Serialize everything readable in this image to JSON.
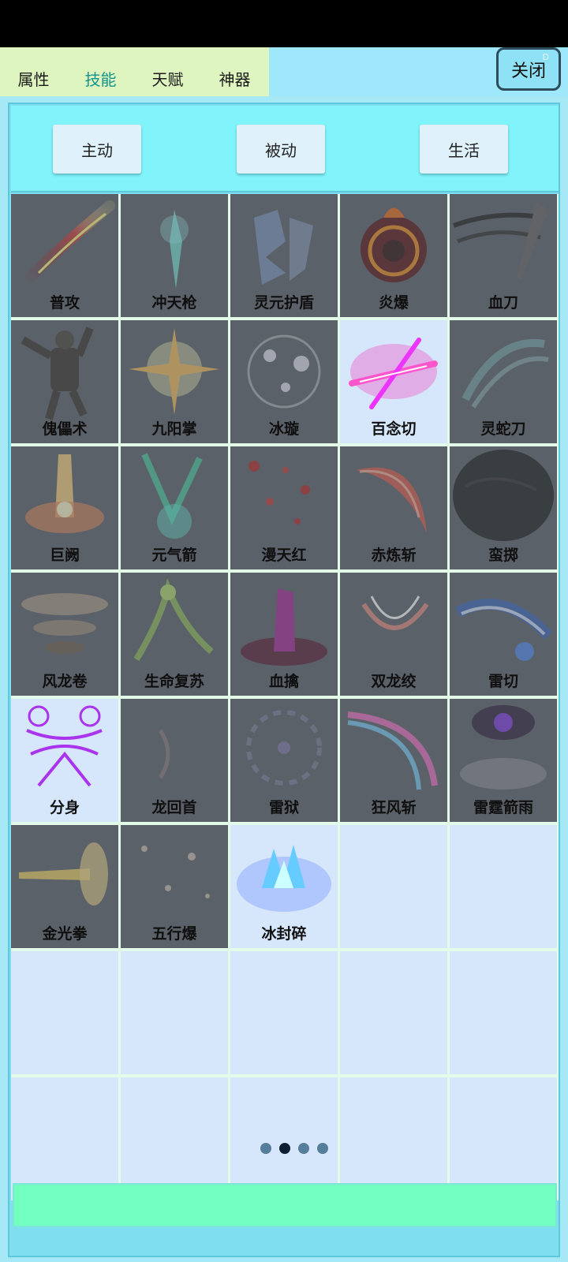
{
  "tabs": [
    {
      "label": "属性",
      "active": false
    },
    {
      "label": "技能",
      "active": true
    },
    {
      "label": "天赋",
      "active": false
    },
    {
      "label": "神器",
      "active": false
    }
  ],
  "close_label": "关闭",
  "close_mark": "D",
  "categories": [
    "主动",
    "被动",
    "生活"
  ],
  "skills": [
    {
      "name": "普攻",
      "unlocked": false,
      "icon": "red-slash-icon"
    },
    {
      "name": "冲天枪",
      "unlocked": false,
      "icon": "cyan-spear-icon"
    },
    {
      "name": "灵元护盾",
      "unlocked": false,
      "icon": "blue-shield-icon"
    },
    {
      "name": "炎爆",
      "unlocked": false,
      "icon": "fire-ring-icon"
    },
    {
      "name": "血刀",
      "unlocked": false,
      "icon": "blade-icon"
    },
    {
      "name": "傀儡术",
      "unlocked": false,
      "icon": "puppet-icon"
    },
    {
      "name": "九阳掌",
      "unlocked": false,
      "icon": "sun-burst-icon"
    },
    {
      "name": "冰璇",
      "unlocked": false,
      "icon": "ice-swirl-icon"
    },
    {
      "name": "百念切",
      "unlocked": true,
      "icon": "pink-cross-slash-icon"
    },
    {
      "name": "灵蛇刀",
      "unlocked": false,
      "icon": "wave-icon"
    },
    {
      "name": "巨阙",
      "unlocked": false,
      "icon": "flame-pillar-icon"
    },
    {
      "name": "元气箭",
      "unlocked": false,
      "icon": "green-arrow-icon"
    },
    {
      "name": "漫天红",
      "unlocked": false,
      "icon": "red-dots-icon"
    },
    {
      "name": "赤炼斩",
      "unlocked": false,
      "icon": "red-crescent-icon"
    },
    {
      "name": "蛮掷",
      "unlocked": false,
      "icon": "boulder-icon"
    },
    {
      "name": "风龙卷",
      "unlocked": false,
      "icon": "tornado-icon"
    },
    {
      "name": "生命复苏",
      "unlocked": false,
      "icon": "vine-icon"
    },
    {
      "name": "血擒",
      "unlocked": false,
      "icon": "blood-claw-icon"
    },
    {
      "name": "双龙绞",
      "unlocked": false,
      "icon": "twin-dragon-icon"
    },
    {
      "name": "雷切",
      "unlocked": false,
      "icon": "lightning-wave-icon"
    },
    {
      "name": "分身",
      "unlocked": true,
      "icon": "clone-icon"
    },
    {
      "name": "龙回首",
      "unlocked": false,
      "icon": "faint-arc-icon"
    },
    {
      "name": "雷狱",
      "unlocked": false,
      "icon": "thunder-ring-icon"
    },
    {
      "name": "狂风斩",
      "unlocked": false,
      "icon": "wind-slash-icon"
    },
    {
      "name": "雷霆箭雨",
      "unlocked": false,
      "icon": "storm-cloud-icon"
    },
    {
      "name": "金光拳",
      "unlocked": false,
      "icon": "golden-fist-icon"
    },
    {
      "name": "五行爆",
      "unlocked": false,
      "icon": "sparkle-icon"
    },
    {
      "name": "冰封碎",
      "unlocked": true,
      "icon": "ice-crystal-icon"
    }
  ],
  "empty_slots": 12,
  "pages": {
    "count": 4,
    "current": 2
  },
  "colors": {
    "accent_tab": "#15938c",
    "locked_cell": "#5b6168",
    "unlocked_cell": "#d6e7fb",
    "footer": "#72ffc0"
  }
}
